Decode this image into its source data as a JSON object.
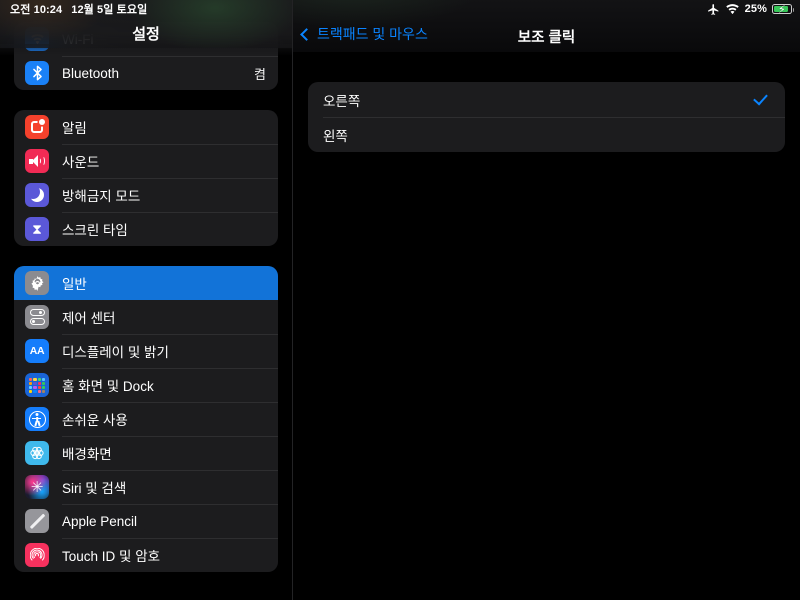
{
  "status_bar": {
    "time": "오전 10:24",
    "date": "12월 5일 토요일",
    "airplane_icon": "airplane-mode-icon",
    "wifi_icon": "wifi-icon",
    "battery_percent": "25%",
    "battery_level": 25,
    "battery_charging": true,
    "battery_color": "#38c759"
  },
  "sidebar": {
    "title": "설정",
    "selected_item": "일반",
    "selected_color": "#1273d8",
    "groups": [
      {
        "id": "connectivity",
        "items": [
          {
            "label": "Wi-Fi",
            "value": "",
            "icon": "wifi-icon",
            "icon_class": "ic-wifi",
            "obscured": true
          },
          {
            "label": "Bluetooth",
            "value": "켬",
            "icon": "bluetooth-icon",
            "icon_class": "ic-bluetooth",
            "obscured": false
          }
        ]
      },
      {
        "id": "alerts",
        "items": [
          {
            "label": "알림",
            "value": "",
            "icon": "notifications-icon",
            "icon_class": "ic-notif"
          },
          {
            "label": "사운드",
            "value": "",
            "icon": "sound-icon",
            "icon_class": "ic-sound"
          },
          {
            "label": "방해금지 모드",
            "value": "",
            "icon": "do-not-disturb-icon",
            "icon_class": "ic-dnd"
          },
          {
            "label": "스크린 타임",
            "value": "",
            "icon": "screen-time-icon",
            "icon_class": "ic-screen"
          }
        ]
      },
      {
        "id": "system",
        "items": [
          {
            "label": "일반",
            "value": "",
            "icon": "gear-icon",
            "icon_class": "ic-general",
            "selected": true
          },
          {
            "label": "제어 센터",
            "value": "",
            "icon": "control-center-icon",
            "icon_class": "ic-control"
          },
          {
            "label": "디스플레이 및 밝기",
            "value": "",
            "icon": "display-brightness-icon",
            "icon_class": "ic-display"
          },
          {
            "label": "홈 화면 및 Dock",
            "value": "",
            "icon": "home-screen-dock-icon",
            "icon_class": "ic-home"
          },
          {
            "label": "손쉬운 사용",
            "value": "",
            "icon": "accessibility-icon",
            "icon_class": "ic-access"
          },
          {
            "label": "배경화면",
            "value": "",
            "icon": "wallpaper-icon",
            "icon_class": "ic-wallpaper"
          },
          {
            "label": "Siri 및 검색",
            "value": "",
            "icon": "siri-icon",
            "icon_class": "ic-siri"
          },
          {
            "label": "Apple Pencil",
            "value": "",
            "icon": "apple-pencil-icon",
            "icon_class": "ic-pencil"
          },
          {
            "label": "Touch ID 및 암호",
            "value": "",
            "icon": "touch-id-icon",
            "icon_class": "ic-touchid"
          }
        ]
      }
    ]
  },
  "content": {
    "back_label": "트랙패드 및 마우스",
    "title": "보조 클릭",
    "accent_color": "#0a84ff",
    "options": [
      {
        "label": "오른쪽",
        "checked": true
      },
      {
        "label": "왼쪽",
        "checked": false
      }
    ]
  }
}
